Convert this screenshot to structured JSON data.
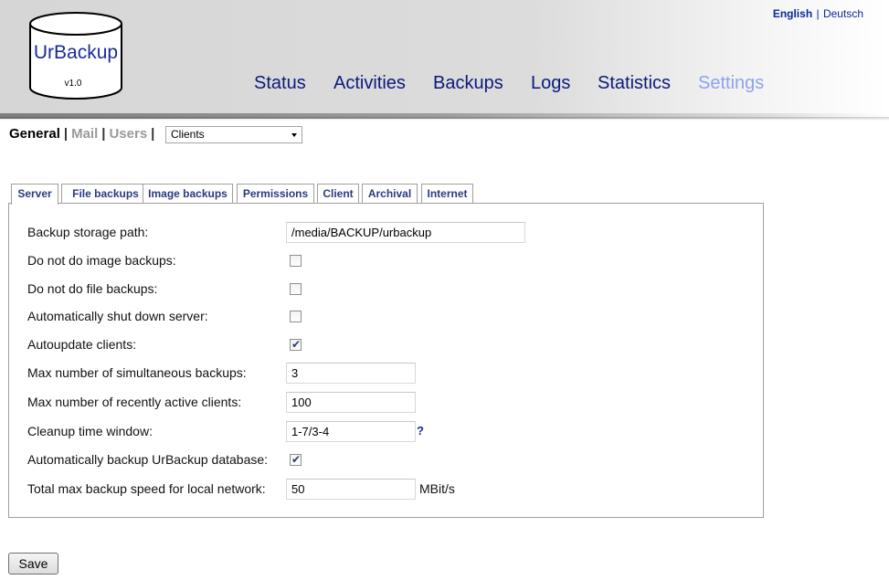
{
  "language": {
    "active": "English",
    "separator": "|",
    "other": "Deutsch"
  },
  "logo": {
    "text": "UrBackup",
    "version": "v1.0"
  },
  "nav": {
    "items": [
      "Status",
      "Activities",
      "Backups",
      "Logs",
      "Statistics",
      "Settings"
    ],
    "current": "Settings"
  },
  "subnav": {
    "general": "General",
    "mail": "Mail",
    "users": "Users",
    "separator": "|",
    "clients_select": "Clients"
  },
  "tabs": [
    "Server",
    "File backups",
    "Image backups",
    "Permissions",
    "Client",
    "Archival",
    "Internet"
  ],
  "server_settings": {
    "backup_storage_path": {
      "label": "Backup storage path:",
      "value": "/media/BACKUP/urbackup"
    },
    "no_image_backups": {
      "label": "Do not do image backups:",
      "checked": false
    },
    "no_file_backups": {
      "label": "Do not do file backups:",
      "checked": false
    },
    "auto_shutdown": {
      "label": "Automatically shut down server:",
      "checked": false
    },
    "autoupdate_clients": {
      "label": "Autoupdate clients:",
      "checked": true
    },
    "max_simultaneous": {
      "label": "Max number of simultaneous backups:",
      "value": "3"
    },
    "max_active_clients": {
      "label": "Max number of recently active clients:",
      "value": "100"
    },
    "cleanup_window": {
      "label": "Cleanup time window:",
      "value": "1-7/3-4",
      "help": "?"
    },
    "backup_database": {
      "label": "Automatically backup UrBackup database:",
      "checked": true
    },
    "max_speed_local": {
      "label": "Total max backup speed for local network:",
      "value": "50",
      "unit": "MBit/s"
    }
  },
  "save_label": "Save",
  "checkmark": "✔",
  "colors": {
    "nav": "#0b1a7a",
    "nav_current": "#8ea3ee",
    "tab_text": "#2b3a80"
  }
}
